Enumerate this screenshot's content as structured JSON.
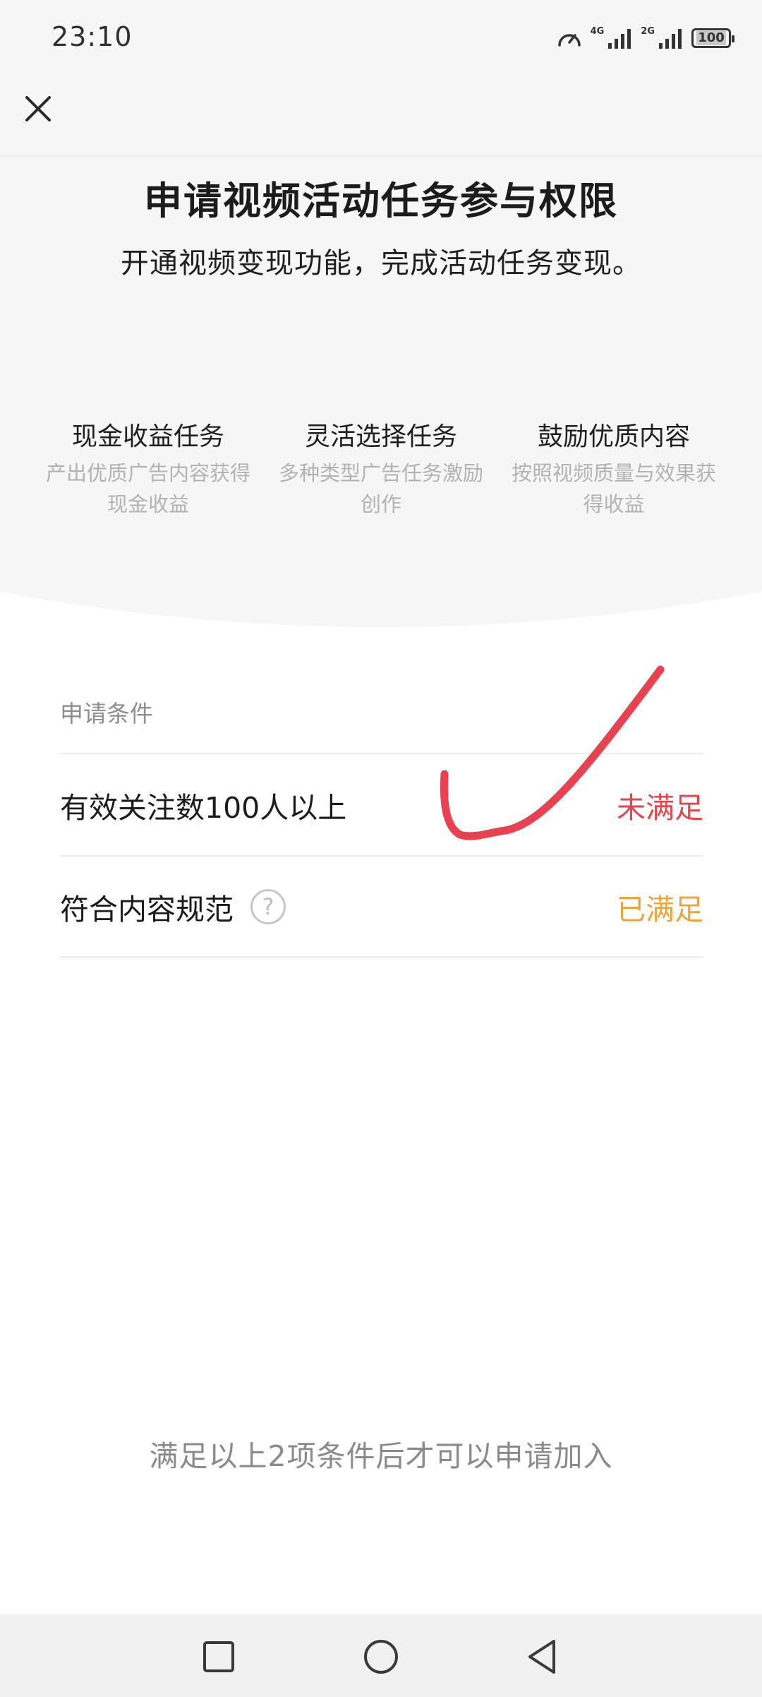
{
  "status_bar": {
    "time": "23:10",
    "network_1": "4G",
    "network_2": "2G",
    "battery": "100"
  },
  "header": {
    "title": "申请视频活动任务参与权限",
    "subtitle": "开通视频变现功能，完成活动任务变现。"
  },
  "features": [
    {
      "title": "现金收益任务",
      "desc": "产出优质广告内容获得现金收益"
    },
    {
      "title": "灵活选择任务",
      "desc": "多种类型广告任务激励创作"
    },
    {
      "title": "鼓励优质内容",
      "desc": "按照视频质量与效果获得收益"
    }
  ],
  "conditions": {
    "label": "申请条件",
    "items": [
      {
        "text": "有效关注数100人以上",
        "status": "未满足"
      },
      {
        "text": "符合内容规范",
        "status": "已满足"
      }
    ]
  },
  "footer": {
    "note": "满足以上2项条件后才可以申请加入"
  },
  "colors": {
    "unmet": "#e0474f",
    "met": "#e9a640",
    "annotation": "#e8414f"
  },
  "icons": {
    "close": "close-icon",
    "help": "question-mark-icon",
    "nav_recent": "square-icon",
    "nav_home": "circle-icon",
    "nav_back": "triangle-back-icon"
  }
}
